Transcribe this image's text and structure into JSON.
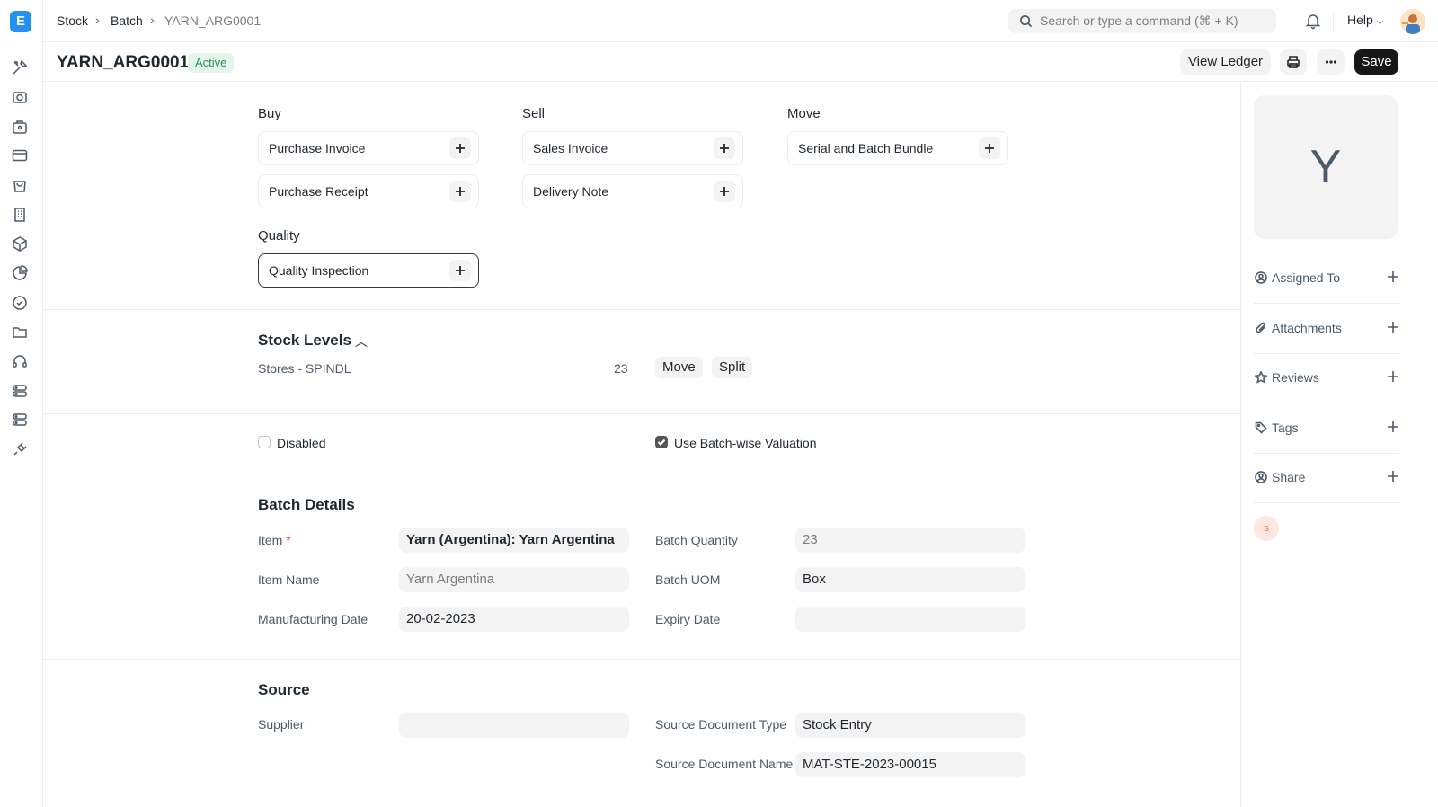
{
  "app": {
    "logo_letter": "E"
  },
  "breadcrumb": [
    "Stock",
    "Batch",
    "YARN_ARG0001"
  ],
  "search": {
    "placeholder": "Search or type a command (⌘ + K)"
  },
  "header": {
    "help_label": "Help"
  },
  "doc": {
    "title": "YARN_ARG0001",
    "status": "Active"
  },
  "actions": {
    "view_ledger": "View Ledger",
    "save": "Save"
  },
  "connections": {
    "buy_label": "Buy",
    "sell_label": "Sell",
    "move_label": "Move",
    "quality_label": "Quality",
    "buy": [
      "Purchase Invoice",
      "Purchase Receipt"
    ],
    "sell": [
      "Sales Invoice",
      "Delivery Note"
    ],
    "move": [
      "Serial and Batch Bundle"
    ],
    "quality": [
      "Quality Inspection"
    ]
  },
  "stock_levels": {
    "title": "Stock Levels",
    "warehouse": "Stores - SPINDL",
    "qty": "23",
    "move_btn": "Move",
    "split_btn": "Split"
  },
  "flags": {
    "disabled_label": "Disabled",
    "disabled_checked": false,
    "batchwise_label": "Use Batch-wise Valuation",
    "batchwise_checked": true
  },
  "batch_details": {
    "title": "Batch Details",
    "item_label": "Item",
    "item_value": "Yarn (Argentina): Yarn Argentina",
    "item_name_label": "Item Name",
    "item_name_value": "Yarn Argentina",
    "mfg_date_label": "Manufacturing Date",
    "mfg_date_value": "20-02-2023",
    "batch_qty_label": "Batch Quantity",
    "batch_qty_value": "23",
    "batch_uom_label": "Batch UOM",
    "batch_uom_value": "Box",
    "expiry_label": "Expiry Date",
    "expiry_value": ""
  },
  "source": {
    "title": "Source",
    "supplier_label": "Supplier",
    "supplier_value": "",
    "src_doc_type_label": "Source Document Type",
    "src_doc_type_value": "Stock Entry",
    "src_doc_name_label": "Source Document Name",
    "src_doc_name_value": "MAT-STE-2023-00015"
  },
  "sidebar_right": {
    "image_letter": "Y",
    "items": [
      "Assigned To",
      "Attachments",
      "Reviews",
      "Tags",
      "Share"
    ],
    "user_initial": "s"
  }
}
